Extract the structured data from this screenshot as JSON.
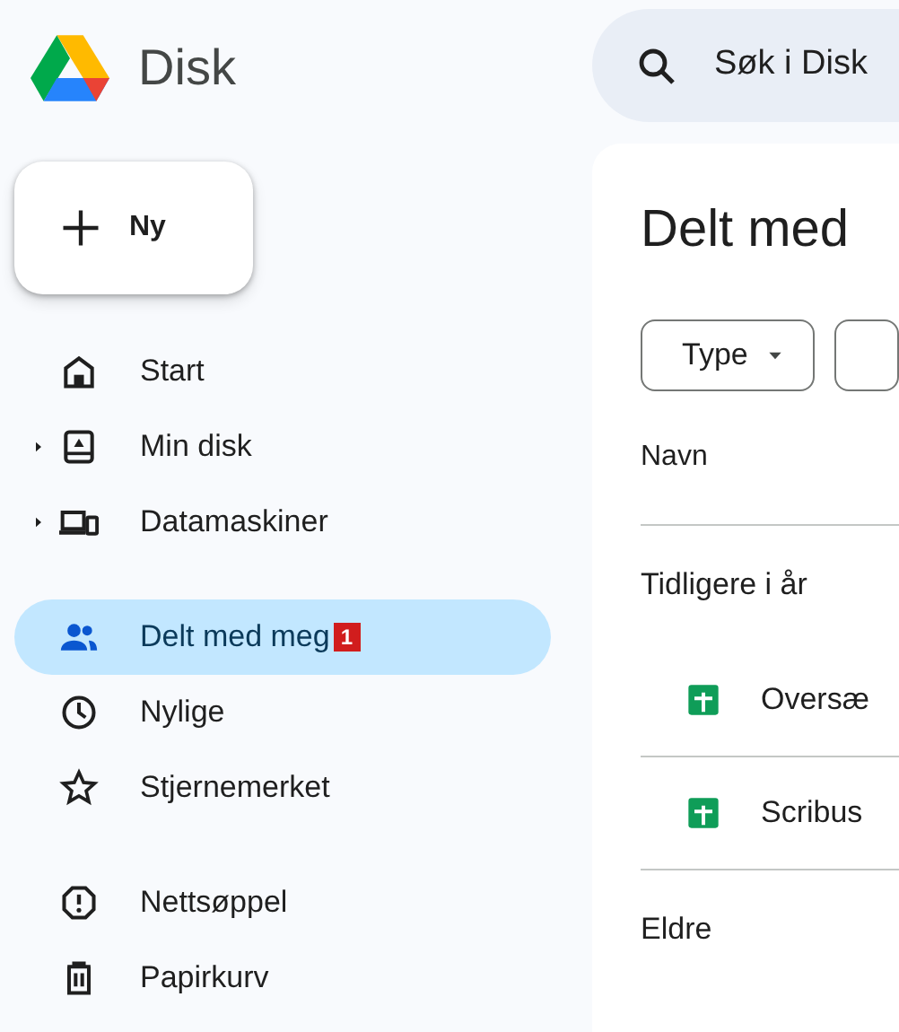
{
  "app": {
    "title": "Disk"
  },
  "new_button": {
    "label": "Ny"
  },
  "search": {
    "placeholder": "Søk i Disk"
  },
  "sidebar": {
    "groups": [
      [
        {
          "label": "Start",
          "selected": false,
          "expandable": false
        },
        {
          "label": "Min disk",
          "selected": false,
          "expandable": true
        },
        {
          "label": "Datamaskiner",
          "selected": false,
          "expandable": true
        }
      ],
      [
        {
          "label": "Delt med meg",
          "selected": true,
          "expandable": false,
          "badge": "1"
        },
        {
          "label": "Nylige",
          "selected": false,
          "expandable": false
        },
        {
          "label": "Stjernemerket",
          "selected": false,
          "expandable": false
        }
      ],
      [
        {
          "label": "Nettsøppel",
          "selected": false,
          "expandable": false
        },
        {
          "label": "Papirkurv",
          "selected": false,
          "expandable": false
        }
      ]
    ]
  },
  "main": {
    "title": "Delt med",
    "filters": [
      {
        "label": "Type"
      }
    ],
    "table": {
      "columns": [
        "Navn"
      ],
      "sections": [
        {
          "heading": "Tidligere i år",
          "rows": [
            {
              "name": "Oversæ",
              "kind": "sheet"
            },
            {
              "name": "Scribus",
              "kind": "sheet"
            }
          ]
        },
        {
          "heading": "Eldre"
        }
      ]
    }
  }
}
